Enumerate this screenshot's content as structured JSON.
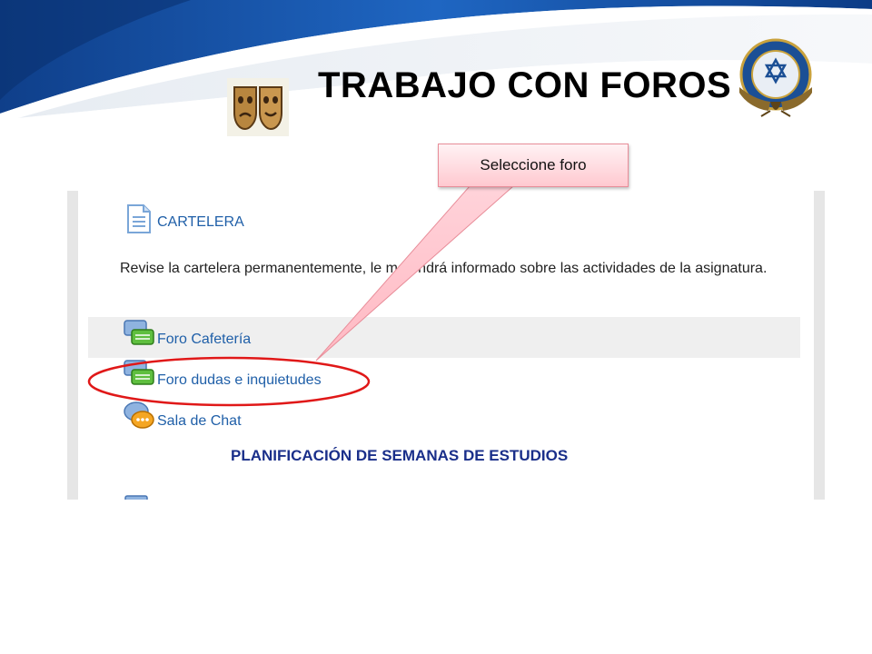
{
  "slide": {
    "title": "TRABAJO CON FOROS",
    "seal_icon": "university-seal-icon",
    "masks_icon": "theater-masks-icon"
  },
  "callout": {
    "text": "Seleccione foro",
    "color": "#ffc9d0"
  },
  "course": {
    "cartelera_label": "CARTELERA",
    "description": "Revise la cartelera permanentemente, le matendrá informado sobre las actividades de la asignatura.",
    "items": [
      {
        "label": "Foro Cafetería",
        "icon": "forum-icon"
      },
      {
        "label": "Foro dudas e inquietudes",
        "icon": "forum-icon"
      },
      {
        "label": "Sala de Chat",
        "icon": "chat-icon"
      }
    ],
    "section_heading": "PLANIFICACIÓN DE SEMANAS DE ESTUDIOS",
    "link_color": "#1f5fa8",
    "heading_color": "#1a2f8a"
  }
}
